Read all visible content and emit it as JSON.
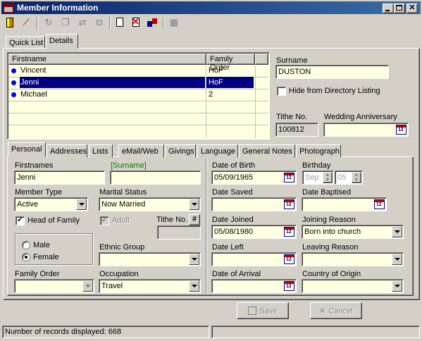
{
  "window": {
    "title": "Member Information"
  },
  "toolbar": {
    "icons": [
      "exit-door-icon",
      "broom-icon",
      "refresh-icon",
      "copy-icon",
      "transfer-icon",
      "merge-icon",
      "new-document-icon",
      "delete-document-icon",
      "family-icon",
      "grid-icon"
    ]
  },
  "top_tabs": [
    {
      "label": "Quick List"
    },
    {
      "label": "Details"
    }
  ],
  "family_list": {
    "headers": {
      "firstname": "Firstname",
      "family_order": "Family Order"
    },
    "rows": [
      {
        "firstname": "Vincent",
        "order": "HoF"
      },
      {
        "firstname": "Jenni",
        "order": "HoF"
      },
      {
        "firstname": "Michael",
        "order": "2"
      }
    ]
  },
  "family": {
    "surname_label": "Surname",
    "surname": "DUSTON",
    "hide_label": "Hide from Directory Listing",
    "tithe_label": "Tithe No.",
    "tithe": "100812",
    "wedding_label": "Wedding Anniversary",
    "wedding": ""
  },
  "detail_tabs": [
    "Personal",
    "Addresses",
    "Lists",
    "eMail/Web",
    "Givings",
    "Language",
    "General Notes",
    "Photograph"
  ],
  "personal": {
    "firstnames_label": "Firstnames",
    "firstnames": "Jenni",
    "surname_label": "[Surname]",
    "surname": "",
    "member_type_label": "Member Type",
    "member_type": "Active",
    "marital_label": "Marital Status",
    "marital": "Now Married",
    "head_label": "Head of Family",
    "adult_label": "Adult",
    "tithe_label": "Tithe No.",
    "tithe_btn": "#",
    "tithe": "",
    "male_label": "Male",
    "female_label": "Female",
    "ethnic_label": "Ethnic Group",
    "ethnic": "",
    "family_order_label": "Family Order",
    "family_order": "",
    "occupation_label": "Occupation",
    "occupation": "Travel",
    "dob_label": "Date of Birth",
    "dob": "05/09/1965",
    "birthday_label": "Birthday",
    "birthday_month": "Sep",
    "birthday_day": "05",
    "saved_label": "Date Saved",
    "saved": "",
    "baptised_label": "Date Baptised",
    "baptised": "",
    "joined_label": "Date Joined",
    "joined": "05/08/1980",
    "join_reason_label": "Joining Reason",
    "join_reason": "Born into church",
    "left_label": "Date Left",
    "left": "",
    "leave_reason_label": "Leaving Reason",
    "leave_reason": "",
    "arrival_label": "Date of Arrival",
    "arrival": "",
    "origin_label": "Country of Origin",
    "origin": ""
  },
  "buttons": {
    "save": "Save",
    "cancel": "Cancel"
  },
  "status": {
    "text": "Number of records displayed: 668"
  }
}
